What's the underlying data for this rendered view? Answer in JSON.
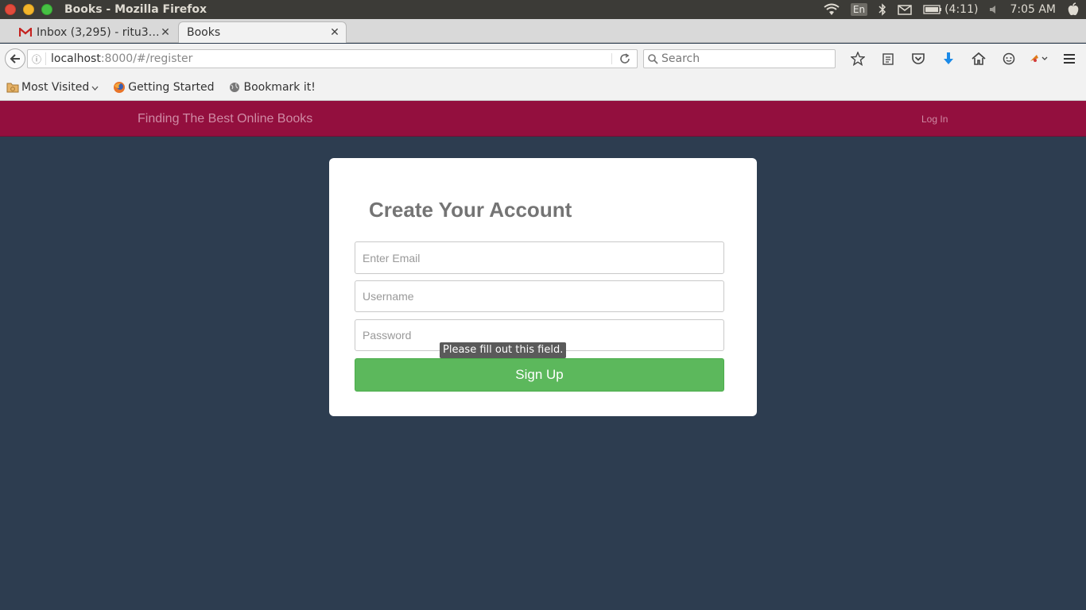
{
  "window": {
    "title": "Books - Mozilla Firefox"
  },
  "tray": {
    "lang": "En",
    "battery": "(4:11)",
    "time": "7:05 AM"
  },
  "tabs": [
    {
      "label": "Inbox (3,295) - ritu3…",
      "icon": "gmail-icon"
    },
    {
      "label": "Books",
      "icon": ""
    }
  ],
  "urlbar": {
    "host": "localhost",
    "path": ":8000/#/register"
  },
  "search": {
    "placeholder": "Search"
  },
  "bookmarks": [
    {
      "label": "Most Visited",
      "icon": "folder-icon"
    },
    {
      "label": "Getting Started",
      "icon": "firefox-icon"
    },
    {
      "label": "Bookmark it!",
      "icon": "globe-icon"
    }
  ],
  "site": {
    "brand": "Finding The Best Online Books",
    "login": "Log In"
  },
  "form": {
    "title": "Create Your Account",
    "email_placeholder": "Enter Email",
    "username_placeholder": "Username",
    "password_placeholder": "Password",
    "validation_tooltip": "Please fill out this field.",
    "submit_label": "Sign Up"
  },
  "colors": {
    "navbar": "#930f3e",
    "page_bg": "#2d3d50",
    "button": "#5cb85c"
  }
}
